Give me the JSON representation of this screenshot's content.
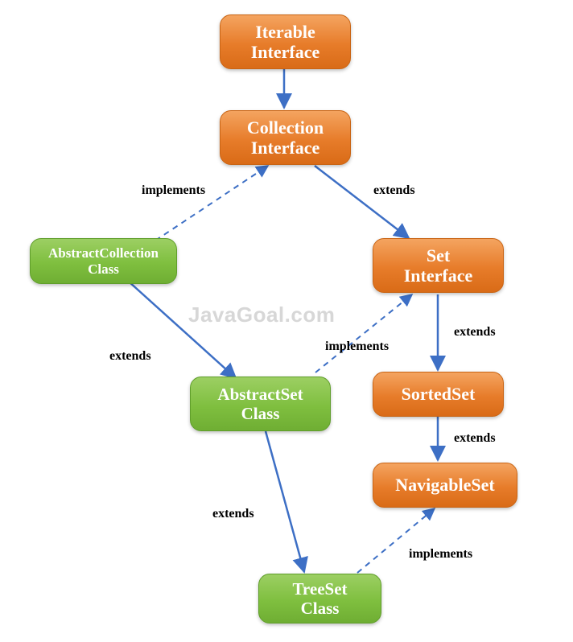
{
  "watermark": "JavaGoal.com",
  "nodes": {
    "iterable": {
      "line1": "Iterable",
      "line2": "Interface"
    },
    "collection": {
      "line1": "Collection",
      "line2": "Interface"
    },
    "abstractCollection": {
      "line1": "AbstractCollection",
      "line2": "Class"
    },
    "set": {
      "line1": "Set",
      "line2": "Interface"
    },
    "abstractSet": {
      "line1": "AbstractSet",
      "line2": "Class"
    },
    "sortedSet": {
      "line1": "SortedSet"
    },
    "navigableSet": {
      "line1": "NavigableSet"
    },
    "treeSet": {
      "line1": "TreeSet",
      "line2": "Class"
    }
  },
  "edgeLabels": {
    "implements1": "implements",
    "extends1": "extends",
    "extends_ac_as": "extends",
    "implements_as_set": "implements",
    "extends_set_sorted": "extends",
    "extends_sorted_nav": "extends",
    "extends_as_tree": "extends",
    "implements_tree_nav": "implements"
  },
  "colors": {
    "interfaceFill": "#e77c2a",
    "classFill": "#7fbf3f",
    "arrowStroke": "#3d6fc5"
  }
}
